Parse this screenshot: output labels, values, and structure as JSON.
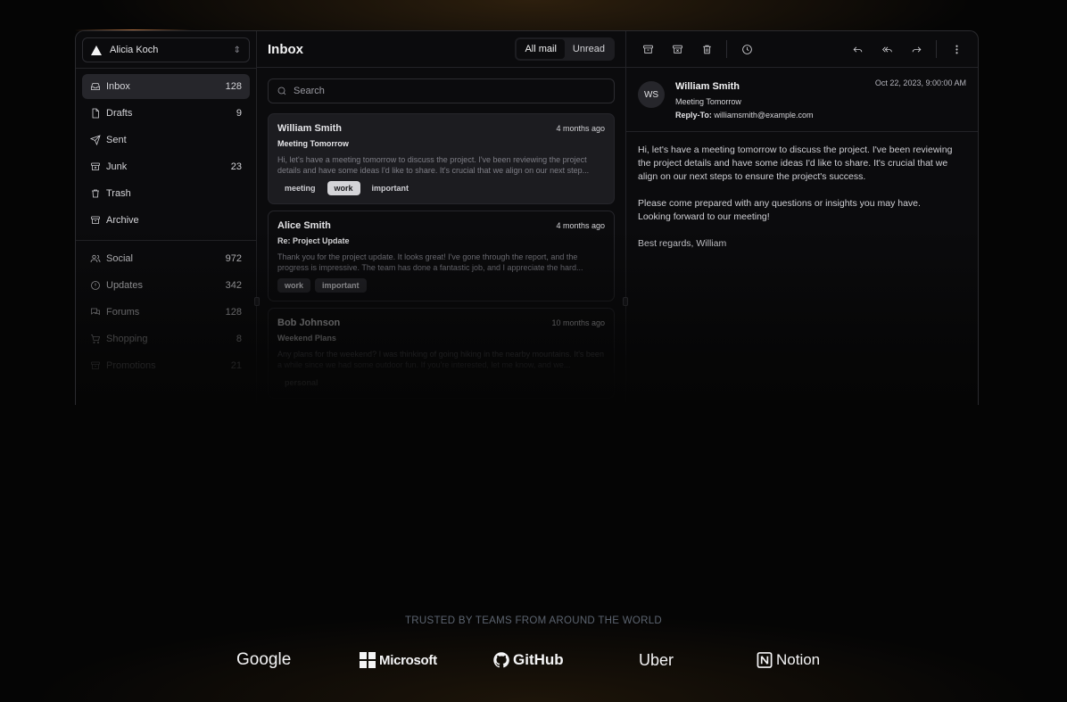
{
  "account": {
    "name": "Alicia Koch"
  },
  "nav_primary": [
    {
      "label": "Inbox",
      "count": "128",
      "icon": "inbox-icon",
      "active": true
    },
    {
      "label": "Drafts",
      "count": "9",
      "icon": "file-icon"
    },
    {
      "label": "Sent",
      "count": "",
      "icon": "send-icon"
    },
    {
      "label": "Junk",
      "count": "23",
      "icon": "archive-x-icon"
    },
    {
      "label": "Trash",
      "count": "",
      "icon": "trash-icon"
    },
    {
      "label": "Archive",
      "count": "",
      "icon": "archive-icon"
    }
  ],
  "nav_secondary": [
    {
      "label": "Social",
      "count": "972",
      "icon": "users-icon"
    },
    {
      "label": "Updates",
      "count": "342",
      "icon": "alert-circle-icon"
    },
    {
      "label": "Forums",
      "count": "128",
      "icon": "messages-icon"
    },
    {
      "label": "Shopping",
      "count": "8",
      "icon": "cart-icon"
    },
    {
      "label": "Promotions",
      "count": "21",
      "icon": "archive-icon"
    }
  ],
  "list": {
    "title": "Inbox",
    "filter_all": "All mail",
    "filter_unread": "Unread",
    "search_placeholder": "Search"
  },
  "mails": [
    {
      "from": "William Smith",
      "when": "4 months ago",
      "subject": "Meeting Tomorrow",
      "preview": "Hi, let's have a meeting tomorrow to discuss the project. I've been reviewing the project details and have some ideas I'd like to share. It's crucial that we align on our next step...",
      "tags": [
        "meeting",
        "work",
        "important"
      ]
    },
    {
      "from": "Alice Smith",
      "when": "4 months ago",
      "subject": "Re: Project Update",
      "preview": "Thank you for the project update. It looks great! I've gone through the report, and the progress is impressive. The team has done a fantastic job, and I appreciate the hard...",
      "tags": [
        "work",
        "important"
      ]
    },
    {
      "from": "Bob Johnson",
      "when": "10 months ago",
      "subject": "Weekend Plans",
      "preview": "Any plans for the weekend? I was thinking of going hiking in the nearby mountains. It's been a while since we had some outdoor fun. If you're interested, let me know, and we...",
      "tags": [
        "personal"
      ]
    }
  ],
  "message": {
    "initials": "WS",
    "from": "William Smith",
    "subject": "Meeting Tomorrow",
    "reply_to_label": "Reply-To:",
    "reply_to": "williamsmith@example.com",
    "date": "Oct 22, 2023, 9:00:00 AM",
    "body": [
      "Hi, let's have a meeting tomorrow to discuss the project. I've been reviewing the project details and have some ideas I'd like to share. It's crucial that we align on our next steps to ensure the project's success.",
      "Please come prepared with any questions or insights you may have.\nLooking forward to our meeting!",
      "Best regards, William"
    ]
  },
  "trusted": {
    "heading": "TRUSTED BY TEAMS FROM AROUND THE WORLD",
    "logos": [
      "Google",
      "Microsoft",
      "GitHub",
      "Uber",
      "Notion"
    ]
  }
}
